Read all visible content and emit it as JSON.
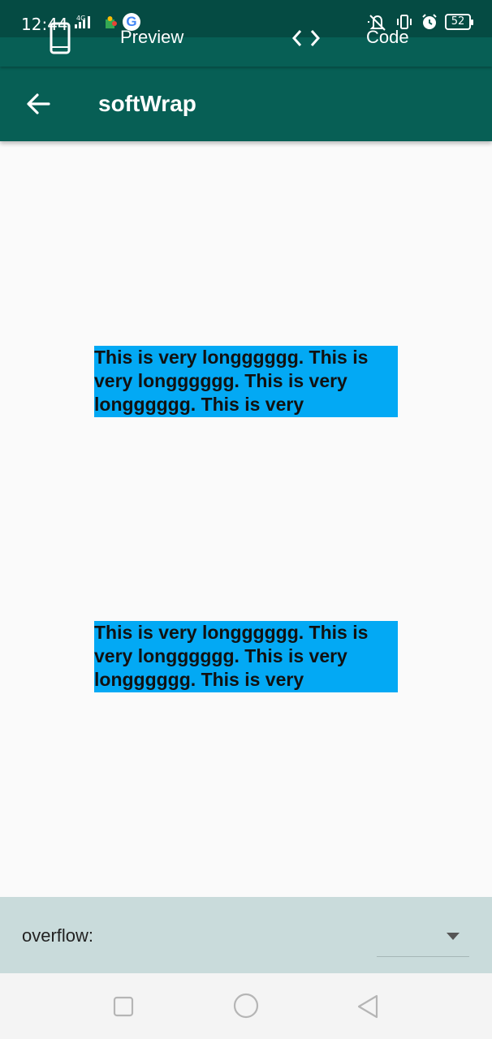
{
  "status_bar": {
    "time": "12:44",
    "network": "4G",
    "battery": "52",
    "icons": [
      "signal-icon",
      "puzzle-icon",
      "google-icon",
      "mute-icon",
      "vibrate-icon",
      "alarm-icon",
      "battery-icon"
    ]
  },
  "top_tabs": {
    "preview_label": "Preview",
    "code_label": "Code"
  },
  "app_bar": {
    "title": "softWrap"
  },
  "demo": {
    "text_1": "This is very longggggg. This is very longggggg. This is very longggggg. This is very",
    "text_2": "This is very longggggg. This is very longggggg. This is very longggggg. This is very"
  },
  "controls": {
    "overflow_label": "overflow:",
    "overflow_value": ""
  },
  "colors": {
    "app_bar": "#075f55",
    "text_background": "#03a9f4",
    "control_panel": "#c9dbdb"
  }
}
